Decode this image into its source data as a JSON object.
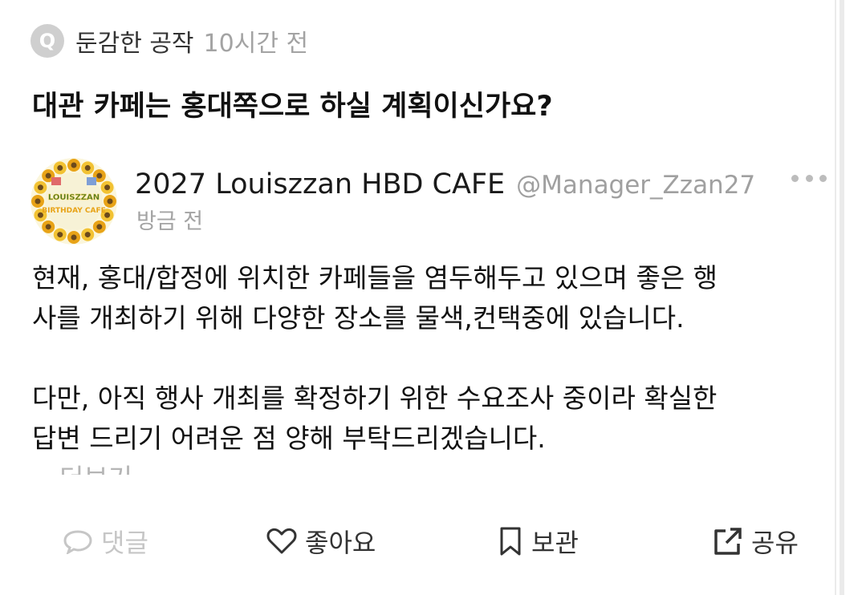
{
  "question": {
    "badge": "Q",
    "asker": "둔감한 공작",
    "time": "10시간 전",
    "text": "대관 카페는 홍대쪽으로 하실 계획이신가요?"
  },
  "answer": {
    "display_name": "2027 Louiszzan HBD CAFE",
    "handle": "@Manager_Zzan27",
    "time": "방금 전",
    "avatar_text": "LOUISZZAN BIRTHDAY CAFE",
    "lines": [
      "현재, 홍대/합정에 위치한 카페들을 염두해두고 있으며 좋은 행",
      "사를 개최하기 위해 다양한 장소를 물색,컨택중에 있습니다.",
      "",
      "다만, 아직 행사 개최를 확정하기 위한 수요조사 중이라 확실한",
      "답변 드리기 어려운 점 양해 부탁드리겠습니다."
    ],
    "more_link": "더보기"
  },
  "actions": {
    "comment": "댓글",
    "like": "좋아요",
    "save": "보관",
    "share": "공유"
  },
  "icons": {
    "more": "more-horizontal-icon",
    "comment": "speech-bubble-icon",
    "like": "heart-icon",
    "save": "bookmark-icon",
    "share": "external-share-icon"
  },
  "colors": {
    "muted_text": "#a3a3a3",
    "disabled": "#c6c6c6",
    "badge": "#cfcfcf",
    "avatar_wreath": "#f2c233"
  }
}
